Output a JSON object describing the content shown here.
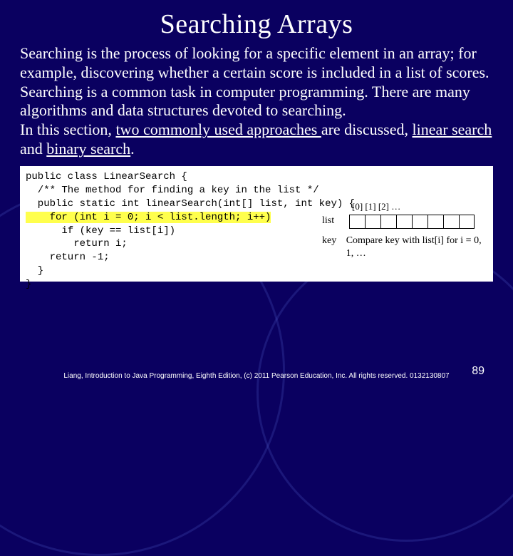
{
  "title": "Searching Arrays",
  "para1": "Searching is the process of looking for a specific element in an array; for example, discovering whether a certain score is included in a list of scores. Searching is a common task in computer programming. There are many algorithms and data structures devoted to searching.",
  "para2a": "In this section, ",
  "para2b": "two commonly used approaches ",
  "para2c": "are discussed, ",
  "para2d": "linear search ",
  "para2e": "and ",
  "para2f": "binary search",
  "para2g": ".",
  "code": {
    "l1": "public class LinearSearch {",
    "l2": "  /** The method for finding a key in the list */",
    "l3": "  public static int linearSearch(int[] list, int key) {",
    "l4": "    for (int i = 0; i < list.length; i++)",
    "l5": "      if (key == list[i])",
    "l6": "        return i;",
    "l7": "    return -1;",
    "l8": "  }",
    "l9": "}"
  },
  "diagram": {
    "indices": "[0] [1] [2] …",
    "listLabel": "list",
    "keyLabel": "key",
    "keyText": "Compare key with list[i] for i = 0, 1, …"
  },
  "footer": "Liang, Introduction to Java Programming, Eighth Edition, (c) 2011 Pearson Education, Inc. All rights reserved. 0132130807",
  "pageNum": "89"
}
